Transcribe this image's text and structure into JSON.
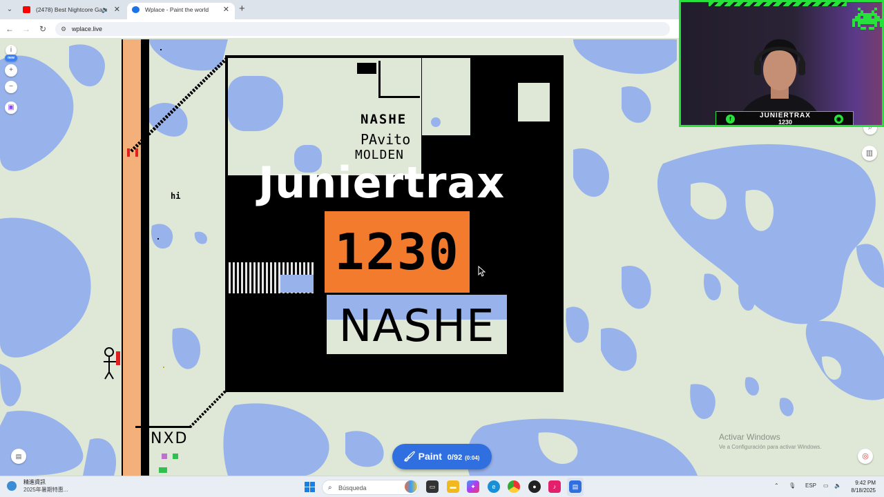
{
  "browser": {
    "tabs": [
      {
        "label": "(2478) Best Nightcore Gam",
        "favicon_color": "#ff0000",
        "active": false
      },
      {
        "label": "Wplace - Paint the world",
        "favicon_color": "#1a73e8",
        "active": true
      }
    ],
    "new_tab_label": "+",
    "url": "wplace.live"
  },
  "map": {
    "left_controls": [
      "i",
      "new",
      "+",
      "−"
    ],
    "canvas_text": {
      "hi": "hi",
      "small_nashe": "NASHE",
      "pavito": "PAvito",
      "molden": "MOLDEN",
      "big_name": "Juniertrax",
      "number": "1230",
      "nashe": "NASHE",
      "nxd": "NXD"
    },
    "colors": {
      "land": "#dfe8d6",
      "water": "#98b3ec",
      "orange": "#f27b2e",
      "road": "#f3b07a"
    }
  },
  "paint_button": {
    "label": "Paint",
    "count": "0/92",
    "timer": "(0:04)"
  },
  "activate_windows": {
    "line1": "Activar Windows",
    "line2": "Ve a Configuración para activar Windows."
  },
  "webcam": {
    "name": "JUNIERTRAX",
    "number": "1230"
  },
  "taskbar": {
    "weather_line1": "精進資訊",
    "weather_line2": "2025年暑期特惠...",
    "search_placeholder": "Búsqueda",
    "lang": "ESP",
    "time": "9:42 PM",
    "date": "8/18/2025"
  }
}
